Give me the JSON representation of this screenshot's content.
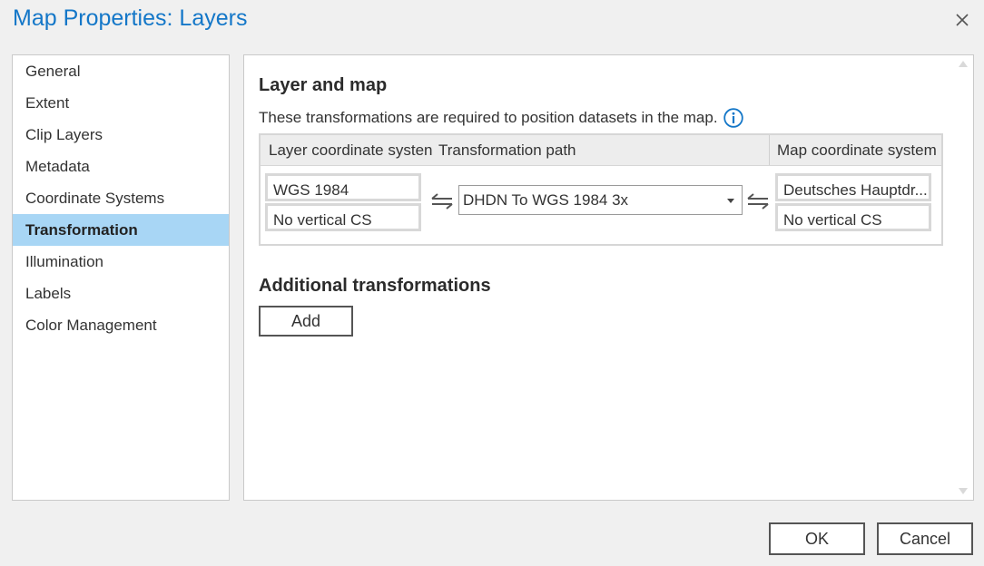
{
  "window": {
    "title": "Map Properties: Layers",
    "close_icon": "close-icon"
  },
  "sidebar": {
    "items": [
      {
        "label": "General",
        "selected": false
      },
      {
        "label": "Extent",
        "selected": false
      },
      {
        "label": "Clip Layers",
        "selected": false
      },
      {
        "label": "Metadata",
        "selected": false
      },
      {
        "label": "Coordinate Systems",
        "selected": false
      },
      {
        "label": "Transformation",
        "selected": true
      },
      {
        "label": "Illumination",
        "selected": false
      },
      {
        "label": "Labels",
        "selected": false
      },
      {
        "label": "Color Management",
        "selected": false
      }
    ]
  },
  "main": {
    "layer_section_title": "Layer and map",
    "description": "These transformations are required to position datasets in the map.",
    "info_icon": "info-icon",
    "grid": {
      "headers": [
        "Layer coordinate systen",
        "Transformation path",
        "Map coordinate system"
      ],
      "layer_cs": {
        "horizontal": "WGS 1984",
        "vertical": "No vertical CS"
      },
      "transformation_path": "DHDN To WGS 1984 3x",
      "map_cs": {
        "horizontal": "Deutsches Hauptdr...",
        "vertical": "No vertical CS"
      }
    },
    "additional_title": "Additional transformations",
    "add_label": "Add"
  },
  "footer": {
    "ok_label": "OK",
    "cancel_label": "Cancel"
  },
  "colors": {
    "title": "#1477c8",
    "selected_item": "#a8d6f5",
    "info_icon": "#1477c8"
  }
}
